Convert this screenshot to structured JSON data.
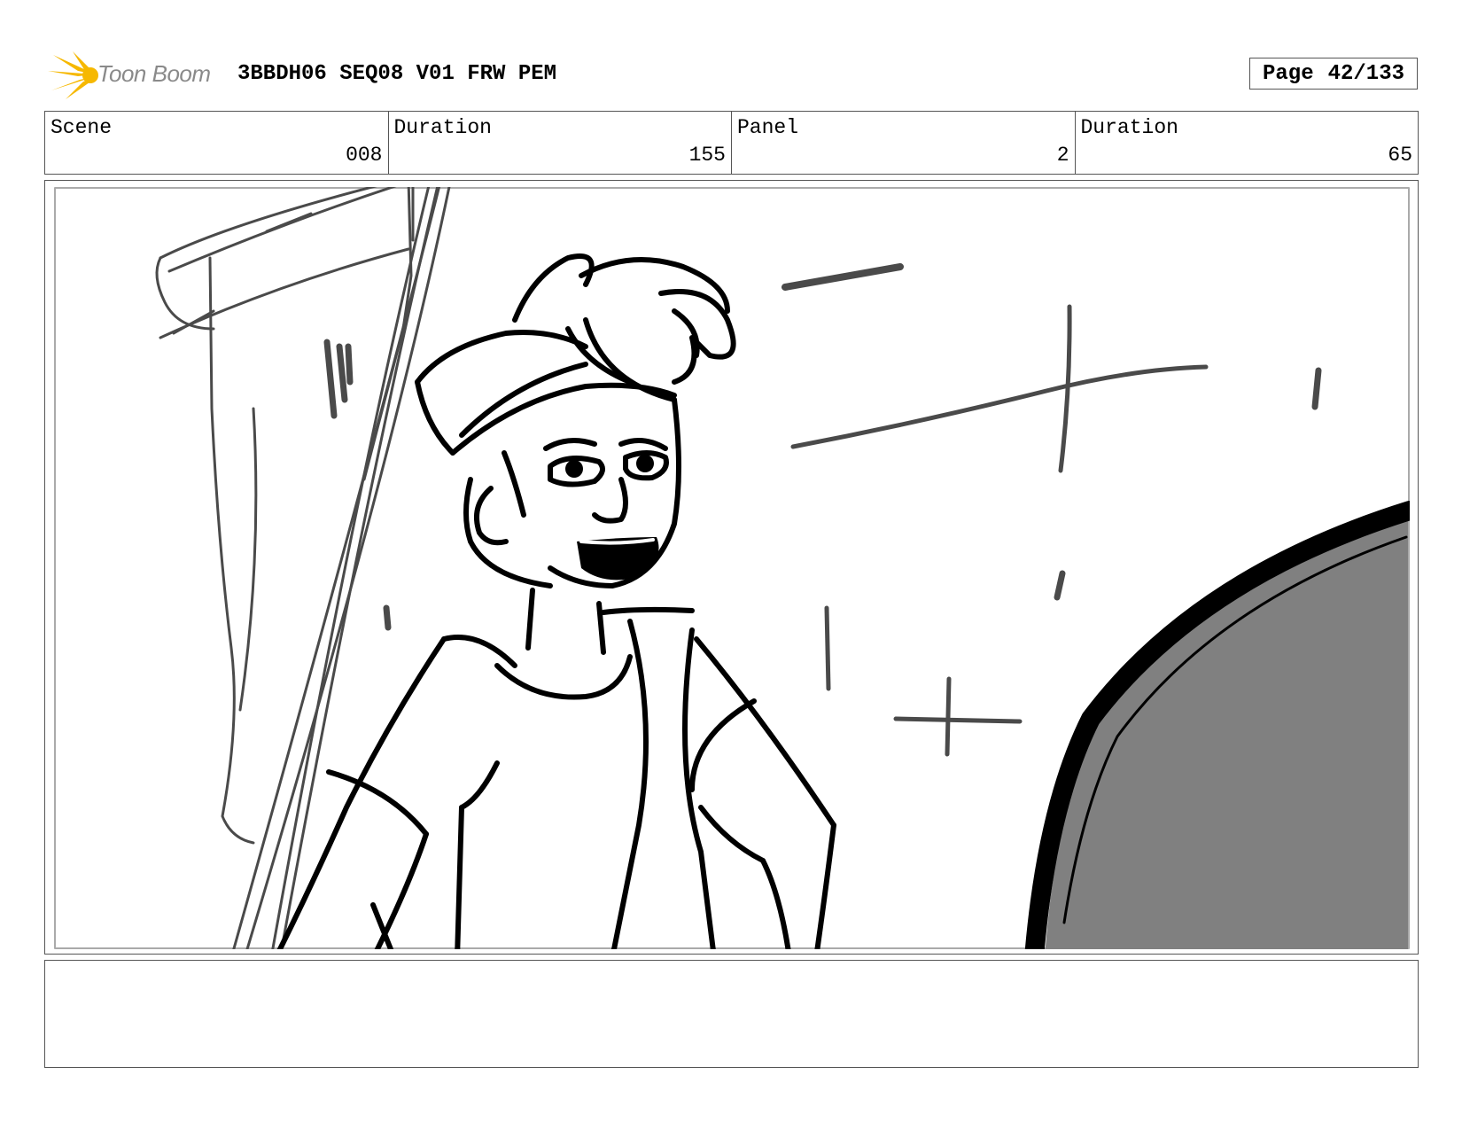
{
  "header": {
    "logo_text": "Toon Boom",
    "title": "3BBDH06 SEQ08 V01 FRW PEM",
    "page_label": "Page",
    "page_number": "42/133"
  },
  "info": {
    "scene_label": "Scene",
    "scene_value": "008",
    "scene_duration_label": "Duration",
    "scene_duration_value": "155",
    "panel_label": "Panel",
    "panel_value": "2",
    "panel_duration_label": "Duration",
    "panel_duration_value": "65"
  },
  "notes": {
    "text": ""
  },
  "colors": {
    "logo_star": "#f6b800",
    "logo_text": "#8a8a8a",
    "border": "#555555",
    "sketch_dark": "#000000",
    "sketch_gray": "#4a4a4a",
    "shadow_fill": "#808080"
  }
}
